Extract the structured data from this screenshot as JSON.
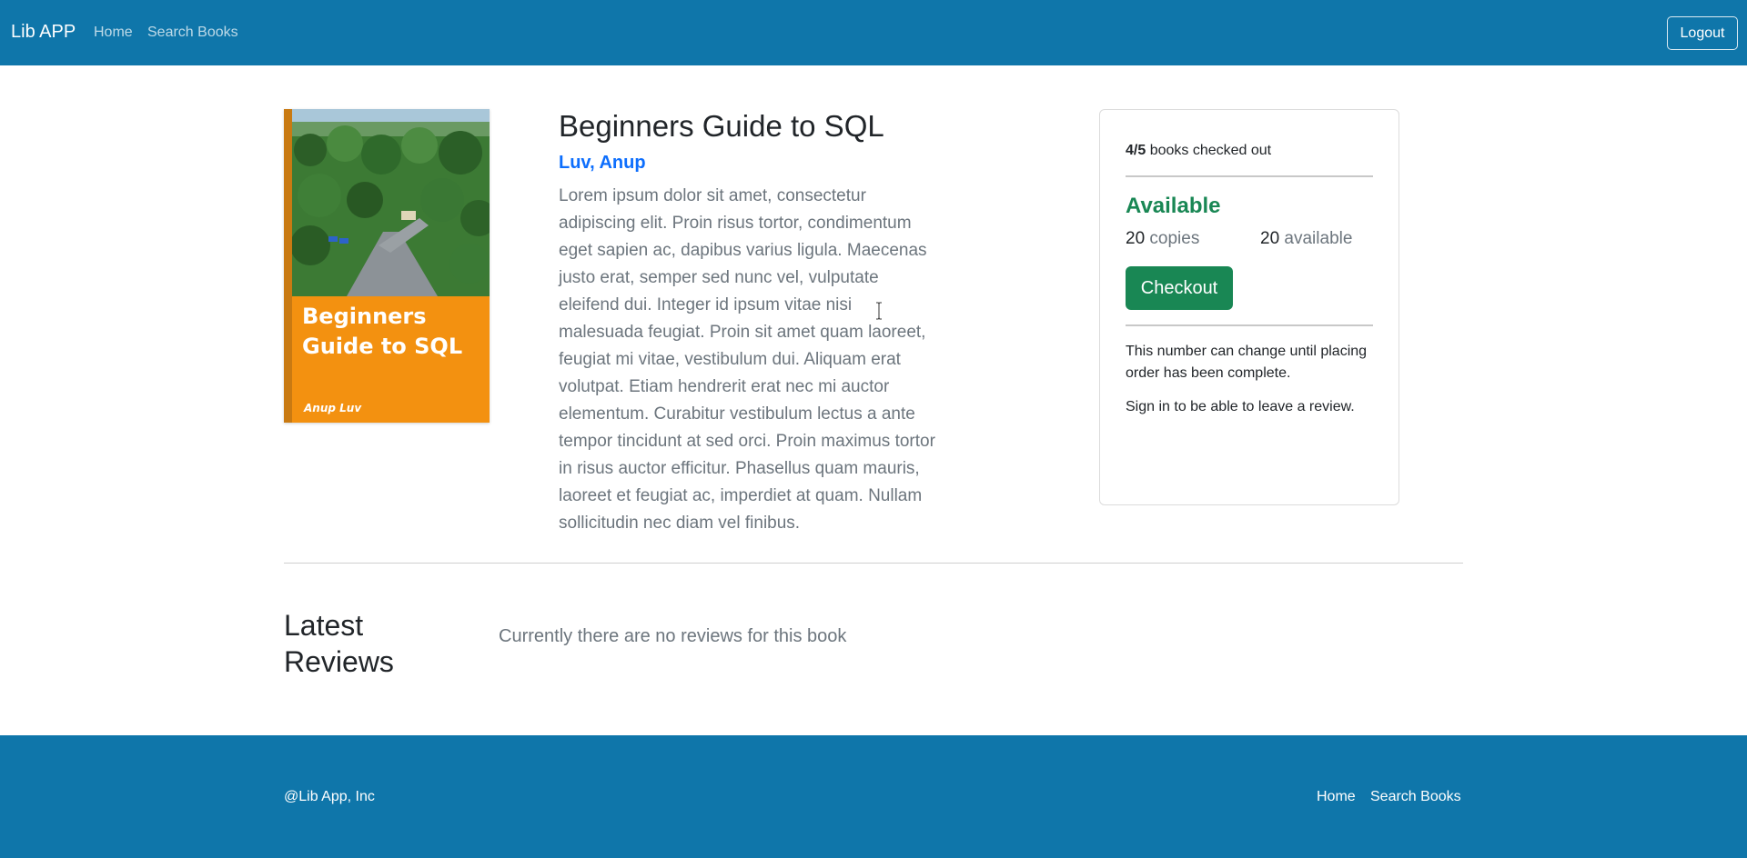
{
  "navbar": {
    "brand": "Lib APP",
    "links": [
      "Home",
      "Search Books"
    ],
    "logout_label": "Logout",
    "color": "#0f76aa"
  },
  "book": {
    "cover": {
      "title": "Beginners Guide to SQL",
      "author": "Anup Luv",
      "color": "#f39110"
    },
    "title": "Beginners Guide to SQL",
    "author": "Luv, Anup",
    "description": "Lorem ipsum dolor sit amet, consectetur adipiscing elit. Proin risus tortor, condimentum eget sapien ac, dapibus varius ligula. Maecenas justo erat, semper sed nunc vel, vulputate eleifend dui. Integer id ipsum vitae nisi malesuada feugiat. Proin sit amet quam laoreet, feugiat mi vitae, vestibulum dui. Aliquam erat volutpat. Etiam hendrerit erat nec mi auctor elementum. Curabitur vestibulum lectus a ante tempor tincidunt at sed orci. Proin maximus tortor in risus auctor efficitur. Phasellus quam mauris, laoreet et feugiat ac, imperdiet at quam. Nullam sollicitudin nec diam vel finibus."
  },
  "checkout_card": {
    "checked_out": "4/5",
    "checked_out_suffix": "books checked out",
    "status": "Available",
    "copies_count": "20",
    "copies_label": "copies",
    "available_count": "20",
    "available_label": "available",
    "checkout_label": "Checkout",
    "note": "This number can change until placing order has been complete.",
    "signin_note": "Sign in to be able to leave a review.",
    "status_color": "#198754"
  },
  "reviews": {
    "title": "Latest Reviews",
    "empty_message": "Currently there are no reviews for this book"
  },
  "footer": {
    "copyright": "@Lib App, Inc",
    "links": [
      "Home",
      "Search Books"
    ]
  }
}
